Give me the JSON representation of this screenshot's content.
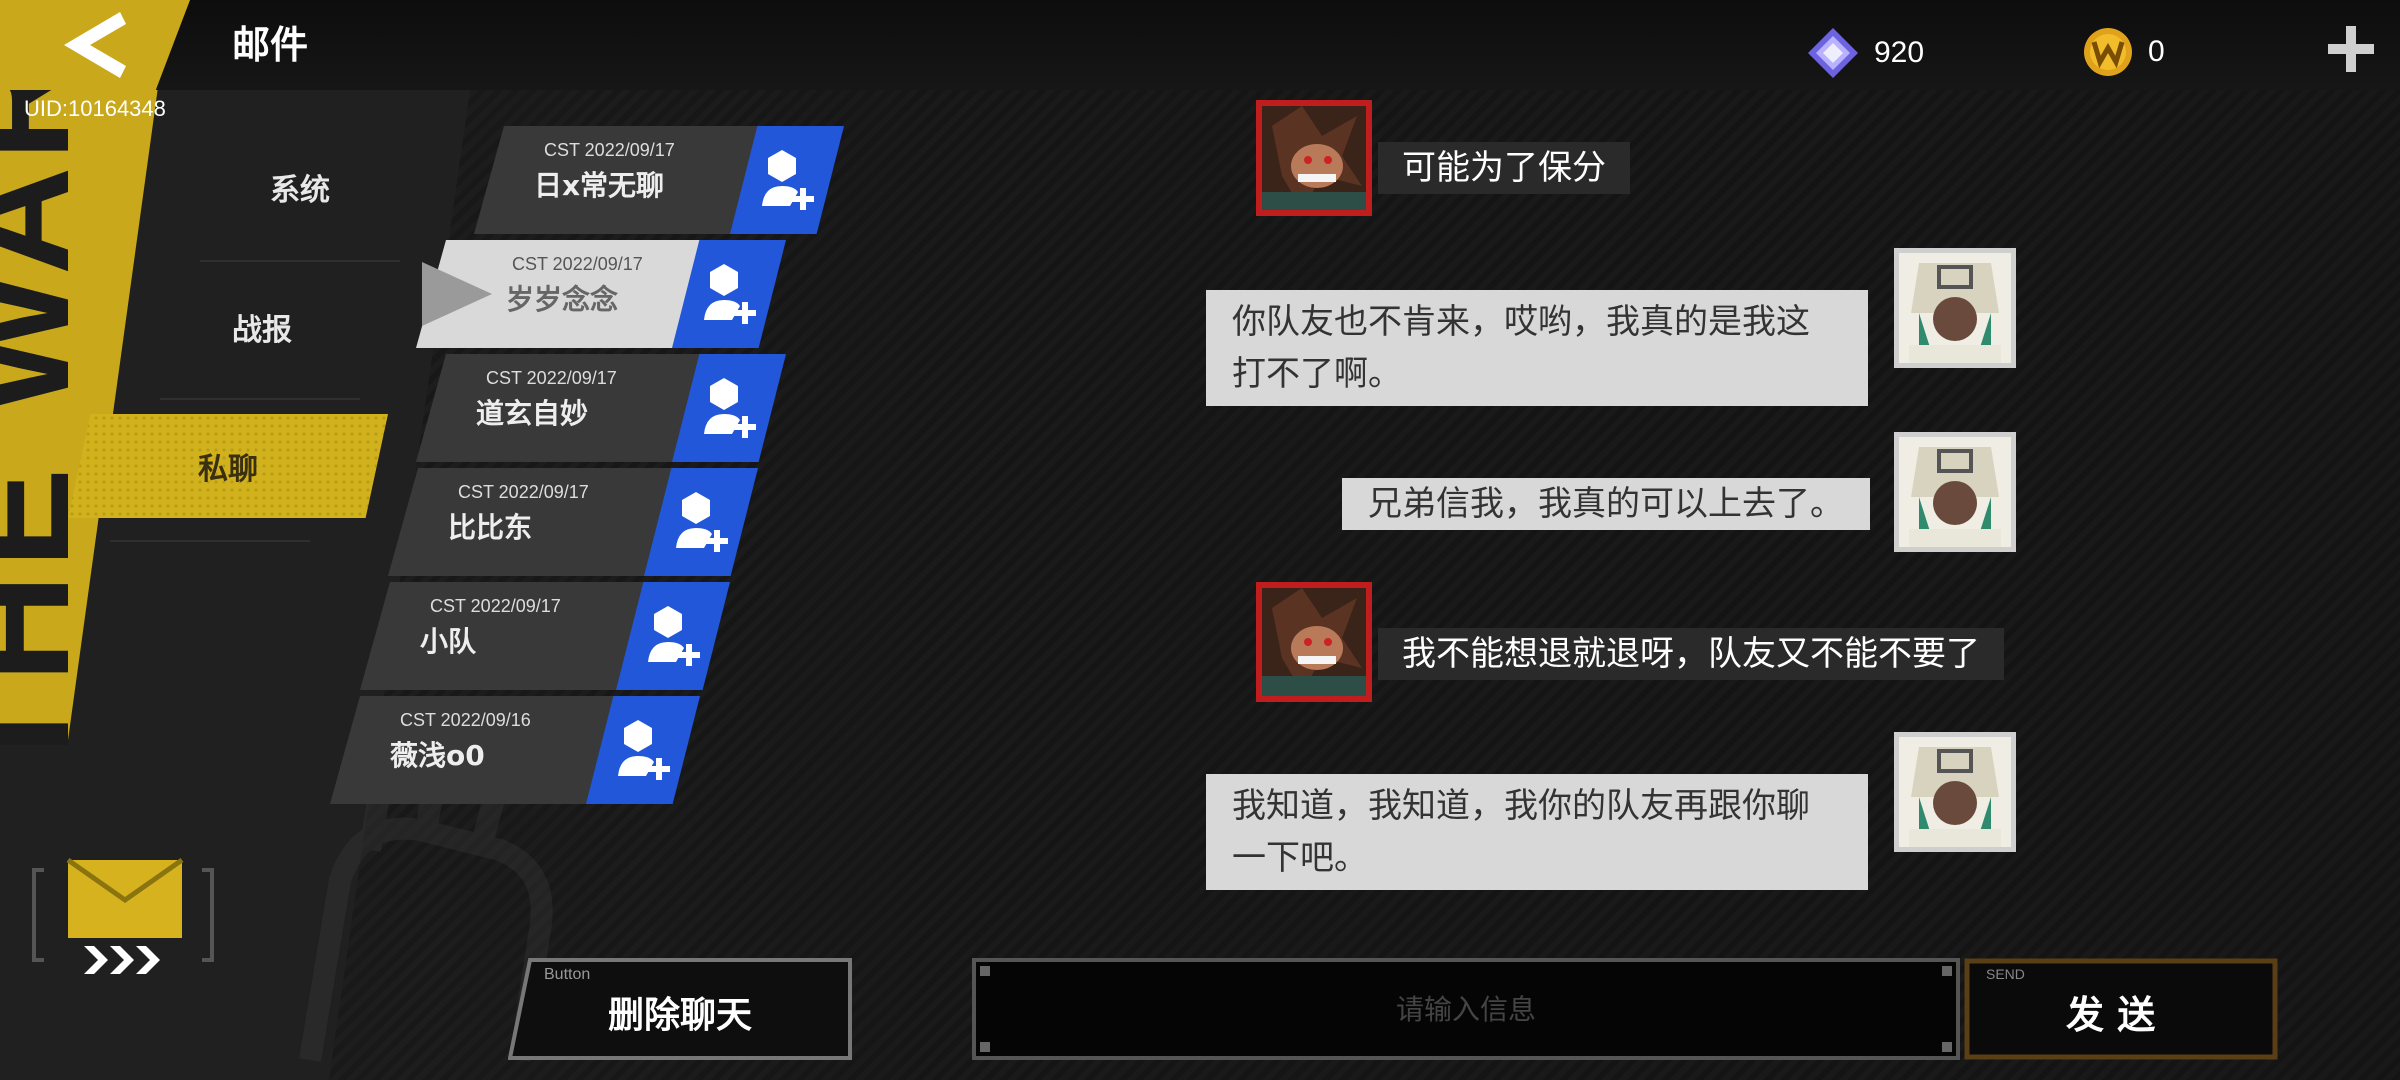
{
  "header": {
    "title": "邮件",
    "uid": "UID:10164348",
    "gem_count": "920",
    "coin_count": "0"
  },
  "background": {
    "side_text": "THE WAR"
  },
  "categories": [
    {
      "label": "系统"
    },
    {
      "label": "战报"
    },
    {
      "label": "私聊"
    }
  ],
  "mails": [
    {
      "date": "CST 2022/09/17",
      "name": "日x常无聊"
    },
    {
      "date": "CST 2022/09/17",
      "name": "岁岁念念"
    },
    {
      "date": "CST 2022/09/17",
      "name": "道玄自妙"
    },
    {
      "date": "CST 2022/09/17",
      "name": "比比东"
    },
    {
      "date": "CST 2022/09/17",
      "name": "小队"
    },
    {
      "date": "CST 2022/09/16",
      "name": "薇浅o0"
    }
  ],
  "messages": [
    {
      "side": "left",
      "text": "可能为了保分"
    },
    {
      "side": "right",
      "line1": "你队友也不肯来，哎哟，我真的是我这",
      "line2": "打不了啊。"
    },
    {
      "side": "right",
      "text": "兄弟信我，我真的可以上去了。"
    },
    {
      "side": "left",
      "text": "我不能想退就退呀，队友又不能不要了"
    },
    {
      "side": "right",
      "line1": "我知道，我知道，我你的队友再跟你聊",
      "line2": "一下吧。"
    }
  ],
  "footer": {
    "delete_tag": "Button",
    "delete_label": "删除聊天",
    "input_placeholder": "请输入信息",
    "send_tag": "SEND",
    "send_label": "发 送"
  },
  "colors": {
    "accent_yellow": "#c9a81c",
    "add_blue": "#2157d8",
    "avatar_red": "#c01e1e",
    "send_border": "#5a3f16"
  }
}
